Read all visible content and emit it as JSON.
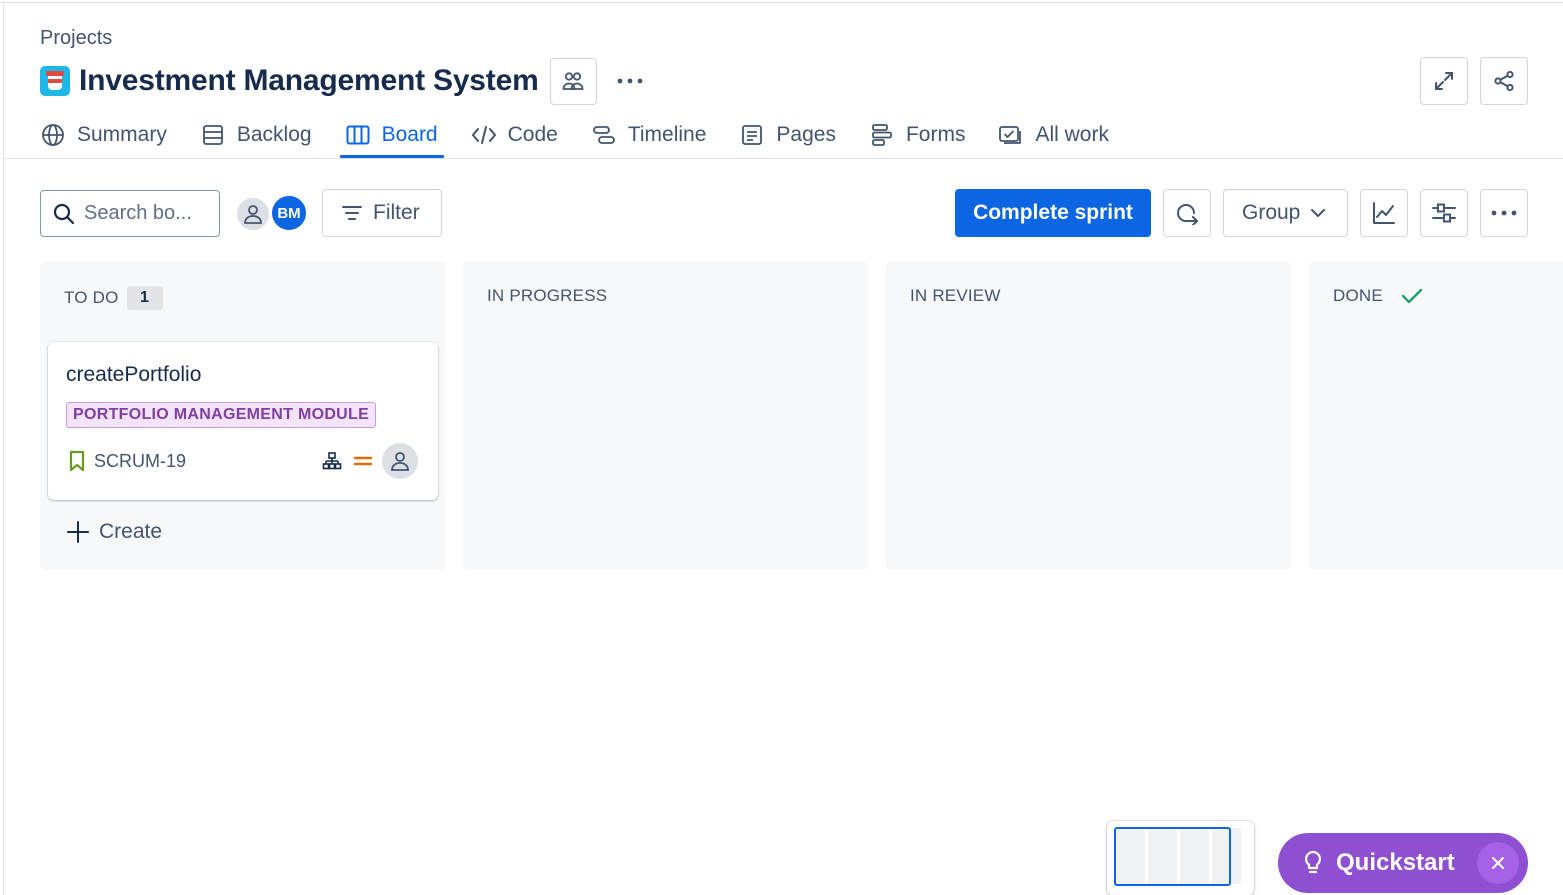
{
  "breadcrumb": "Projects",
  "project": {
    "title": "Investment Management System",
    "icon": "coffee-cup-project-icon"
  },
  "header_actions": {
    "team": "people-icon",
    "more": "ellipsis-icon",
    "expand": "expand-icon",
    "share": "share-icon"
  },
  "tabs": [
    {
      "label": "Summary",
      "icon": "globe-icon"
    },
    {
      "label": "Backlog",
      "icon": "list-icon"
    },
    {
      "label": "Board",
      "icon": "board-icon",
      "active": true
    },
    {
      "label": "Code",
      "icon": "code-icon"
    },
    {
      "label": "Timeline",
      "icon": "timeline-icon"
    },
    {
      "label": "Pages",
      "icon": "page-icon"
    },
    {
      "label": "Forms",
      "icon": "forms-icon"
    },
    {
      "label": "All work",
      "icon": "all-work-icon"
    }
  ],
  "toolbar": {
    "search_placeholder": "Search bo...",
    "avatar_initials": "BM",
    "filter_label": "Filter",
    "complete_sprint_label": "Complete sprint",
    "group_label": "Group"
  },
  "columns": [
    {
      "name": "TO DO",
      "count": "1"
    },
    {
      "name": "IN PROGRESS"
    },
    {
      "name": "IN REVIEW"
    },
    {
      "name": "DONE"
    }
  ],
  "card": {
    "title": "createPortfolio",
    "epic": "PORTFOLIO MANAGEMENT MODULE",
    "key": "SCRUM-19",
    "priority": "medium"
  },
  "create_label": "Create",
  "quickstart_label": "Quickstart",
  "colors": {
    "accent": "#0c66e4",
    "quickstart": "#8f4fd1",
    "epic": "#803fa5",
    "done": "#22a06b"
  }
}
